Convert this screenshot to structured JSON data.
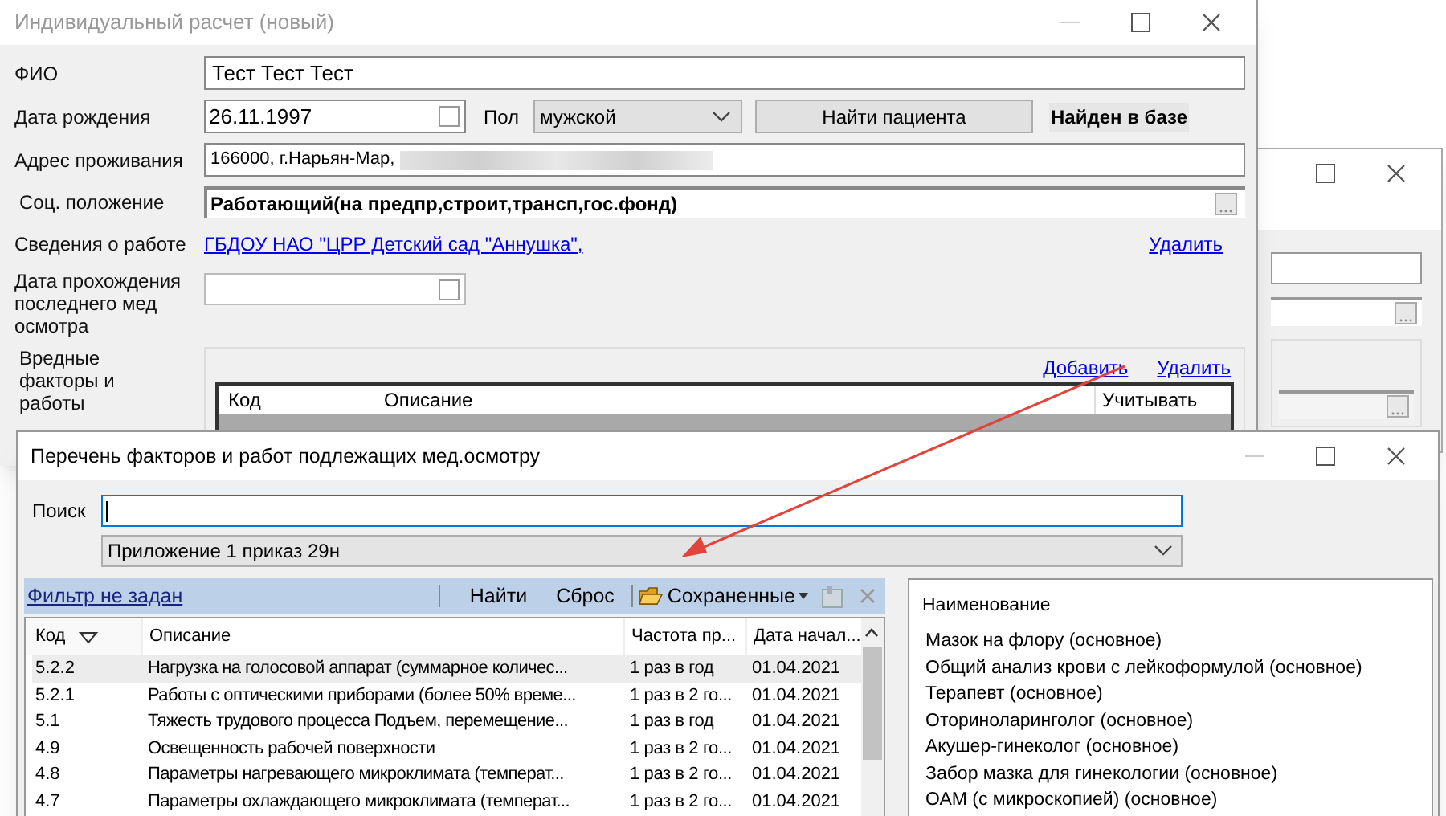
{
  "main_window": {
    "title": "Индивидуальный расчет (новый)",
    "fio": {
      "label": "ФИО",
      "value": "Тест Тест Тест"
    },
    "birth_date": {
      "label": "Дата рождения",
      "value": "26.11.1997"
    },
    "gender": {
      "label": "Пол",
      "value": "мужской"
    },
    "find_button": "Найти пациента",
    "found_status": "Найден в базе",
    "address": {
      "label": "Адрес проживания",
      "value": "166000, г.Нарьян-Мар,",
      "redacted": true
    },
    "social": {
      "label": "Соц. положение",
      "value": "Работающий(на предпр,строит,трансп,гос.фонд)"
    },
    "work": {
      "label": "Сведения о работе",
      "link": "ГБДОУ НАО \"ЦРР  Детский сад \"Аннушка\",",
      "delete": "Удалить"
    },
    "last_exam": {
      "label": "Дата прохождения последнего мед осмотра"
    },
    "factors": {
      "label": "Вредные факторы и работы",
      "add": "Добавить",
      "delete": "Удалить",
      "columns": [
        "Код",
        "Описание",
        "Учитывать"
      ]
    }
  },
  "factors_window": {
    "title": "Перечень факторов и работ подлежащих мед.осмотру",
    "search": {
      "label": "Поиск"
    },
    "dropdown": {
      "value": "Приложение 1 приказ 29н"
    },
    "toolbar": {
      "filter": "Фильтр не задан",
      "buttons": [
        "Найти",
        "Сброс"
      ],
      "saved": "Сохраненные"
    },
    "table": {
      "columns": [
        {
          "label": "Код",
          "sorted": true
        },
        {
          "label": "Описание",
          "sorted": false
        },
        {
          "label": "Частота пр...",
          "sorted": false
        },
        {
          "label": "Дата начал...",
          "sorted": false
        }
      ],
      "rows": [
        {
          "cells": [
            "5.2.2",
            "Нагрузка на голосовой аппарат (суммарное количес...",
            "1 раз в год",
            "01.04.2021"
          ],
          "selected": true
        },
        {
          "cells": [
            "5.2.1",
            "Работы с оптическими приборами (более 50% време...",
            "1 раз в 2 го...",
            "01.04.2021"
          ],
          "selected": false
        },
        {
          "cells": [
            "5.1",
            "Тяжесть трудового процесса Подъем, перемещение...",
            "1 раз в год",
            "01.04.2021"
          ],
          "selected": false
        },
        {
          "cells": [
            "4.9",
            "Освещенность рабочей поверхности",
            "1 раз в 2 го...",
            "01.04.2021"
          ],
          "selected": false
        },
        {
          "cells": [
            "4.8",
            "Параметры нагревающего микроклимата (температ...",
            "1 раз в 2 го...",
            "01.04.2021"
          ],
          "selected": false
        },
        {
          "cells": [
            "4.7",
            "Параметры охлаждающего микроклимата (температ...",
            "1 раз в 2 го...",
            "01.04.2021"
          ],
          "selected": false
        }
      ]
    },
    "services": {
      "header": "Наименование",
      "items": [
        "Мазок на флору (основное)",
        "Общий анализ крови с лейкоформулой (основное)",
        "Терапевт (основное)",
        "Оториноларинголог (основное)",
        "Акушер-гинеколог (основное)",
        "Забор мазка для гинекологии (основное)",
        "ОАМ (с микроскопией) (основное)"
      ]
    }
  }
}
